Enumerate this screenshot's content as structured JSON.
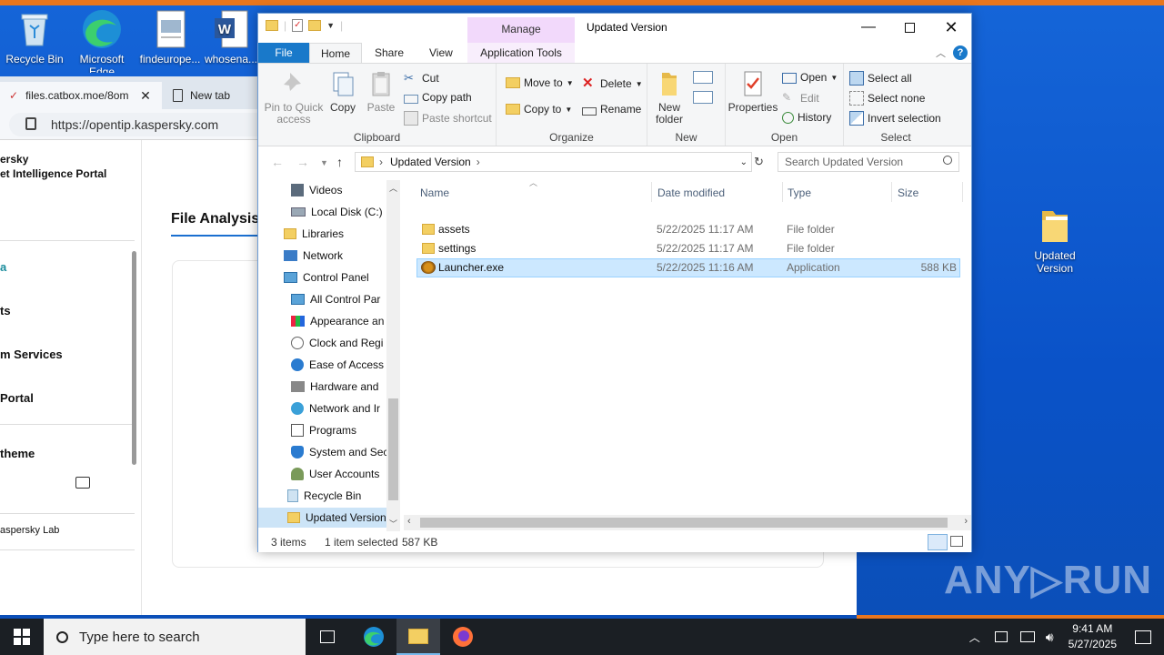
{
  "desktop": {
    "icons": [
      {
        "label": "Recycle Bin"
      },
      {
        "label": "Microsoft Edge"
      },
      {
        "label": "findeurope..."
      },
      {
        "label": "whosena..."
      },
      {
        "label": "Updated Version"
      }
    ]
  },
  "browser": {
    "tabs": [
      {
        "label": "files.catbox.moe/8om"
      },
      {
        "label": "New tab"
      }
    ],
    "url": "https://opentip.kaspersky.com",
    "brand_line1": "ersky",
    "brand_line2": "et Intelligence Portal",
    "left_nav": [
      "a",
      "ts",
      "m Services",
      "Portal",
      "theme"
    ],
    "footer": "aspersky Lab",
    "page_tab": "File Analysis"
  },
  "explorer": {
    "manage_tab": "Manage",
    "window_title": "Updated Version",
    "tabs": {
      "file": "File",
      "home": "Home",
      "share": "Share",
      "view": "View",
      "app_tools": "Application Tools"
    },
    "ribbon": {
      "clipboard": {
        "label": "Clipboard",
        "pin": "Pin to Quick access",
        "copy": "Copy",
        "paste": "Paste",
        "cut": "Cut",
        "copy_path": "Copy path",
        "paste_shortcut": "Paste shortcut"
      },
      "organize": {
        "label": "Organize",
        "move_to": "Move to",
        "copy_to": "Copy to",
        "delete": "Delete",
        "rename": "Rename"
      },
      "new": {
        "label": "New",
        "new_folder": "New folder"
      },
      "open": {
        "label": "Open",
        "properties": "Properties",
        "open": "Open",
        "edit": "Edit",
        "history": "History"
      },
      "select": {
        "label": "Select",
        "select_all": "Select all",
        "select_none": "Select none",
        "invert": "Invert selection"
      }
    },
    "address": {
      "crumb": "Updated Version",
      "search_placeholder": "Search Updated Version"
    },
    "nav_items": [
      {
        "label": "Videos",
        "icon": "videos-icon"
      },
      {
        "label": "Local Disk (C:)",
        "icon": "drive-icon"
      },
      {
        "label": "Libraries",
        "icon": "libraries-icon"
      },
      {
        "label": "Network",
        "icon": "network-icon"
      },
      {
        "label": "Control Panel",
        "icon": "control-panel-icon"
      },
      {
        "label": "All Control Par",
        "icon": "control-panel-icon"
      },
      {
        "label": "Appearance an",
        "icon": "appearance-icon"
      },
      {
        "label": "Clock and Regi",
        "icon": "clock-icon"
      },
      {
        "label": "Ease of Access",
        "icon": "ease-of-access-icon"
      },
      {
        "label": "Hardware and",
        "icon": "hardware-icon"
      },
      {
        "label": "Network and Ir",
        "icon": "network-icon"
      },
      {
        "label": "Programs",
        "icon": "programs-icon"
      },
      {
        "label": "System and Sec",
        "icon": "shield-icon"
      },
      {
        "label": "User Accounts",
        "icon": "users-icon"
      },
      {
        "label": "Recycle Bin",
        "icon": "recycle-bin-icon"
      },
      {
        "label": "Updated Version",
        "icon": "folder-icon"
      }
    ],
    "columns": {
      "name": "Name",
      "date": "Date modified",
      "type": "Type",
      "size": "Size"
    },
    "files": [
      {
        "name": "assets",
        "date": "5/22/2025 11:17 AM",
        "type": "File folder",
        "size": ""
      },
      {
        "name": "settings",
        "date": "5/22/2025 11:17 AM",
        "type": "File folder",
        "size": ""
      },
      {
        "name": "Launcher.exe",
        "date": "5/22/2025 11:16 AM",
        "type": "Application",
        "size": "588 KB"
      }
    ],
    "status": {
      "count": "3 items",
      "selected": "1 item selected",
      "size": "587 KB"
    }
  },
  "watermark": "ANY▷RUN",
  "taskbar": {
    "search_placeholder": "Type here to search",
    "time": "9:41 AM",
    "date": "5/27/2025"
  }
}
